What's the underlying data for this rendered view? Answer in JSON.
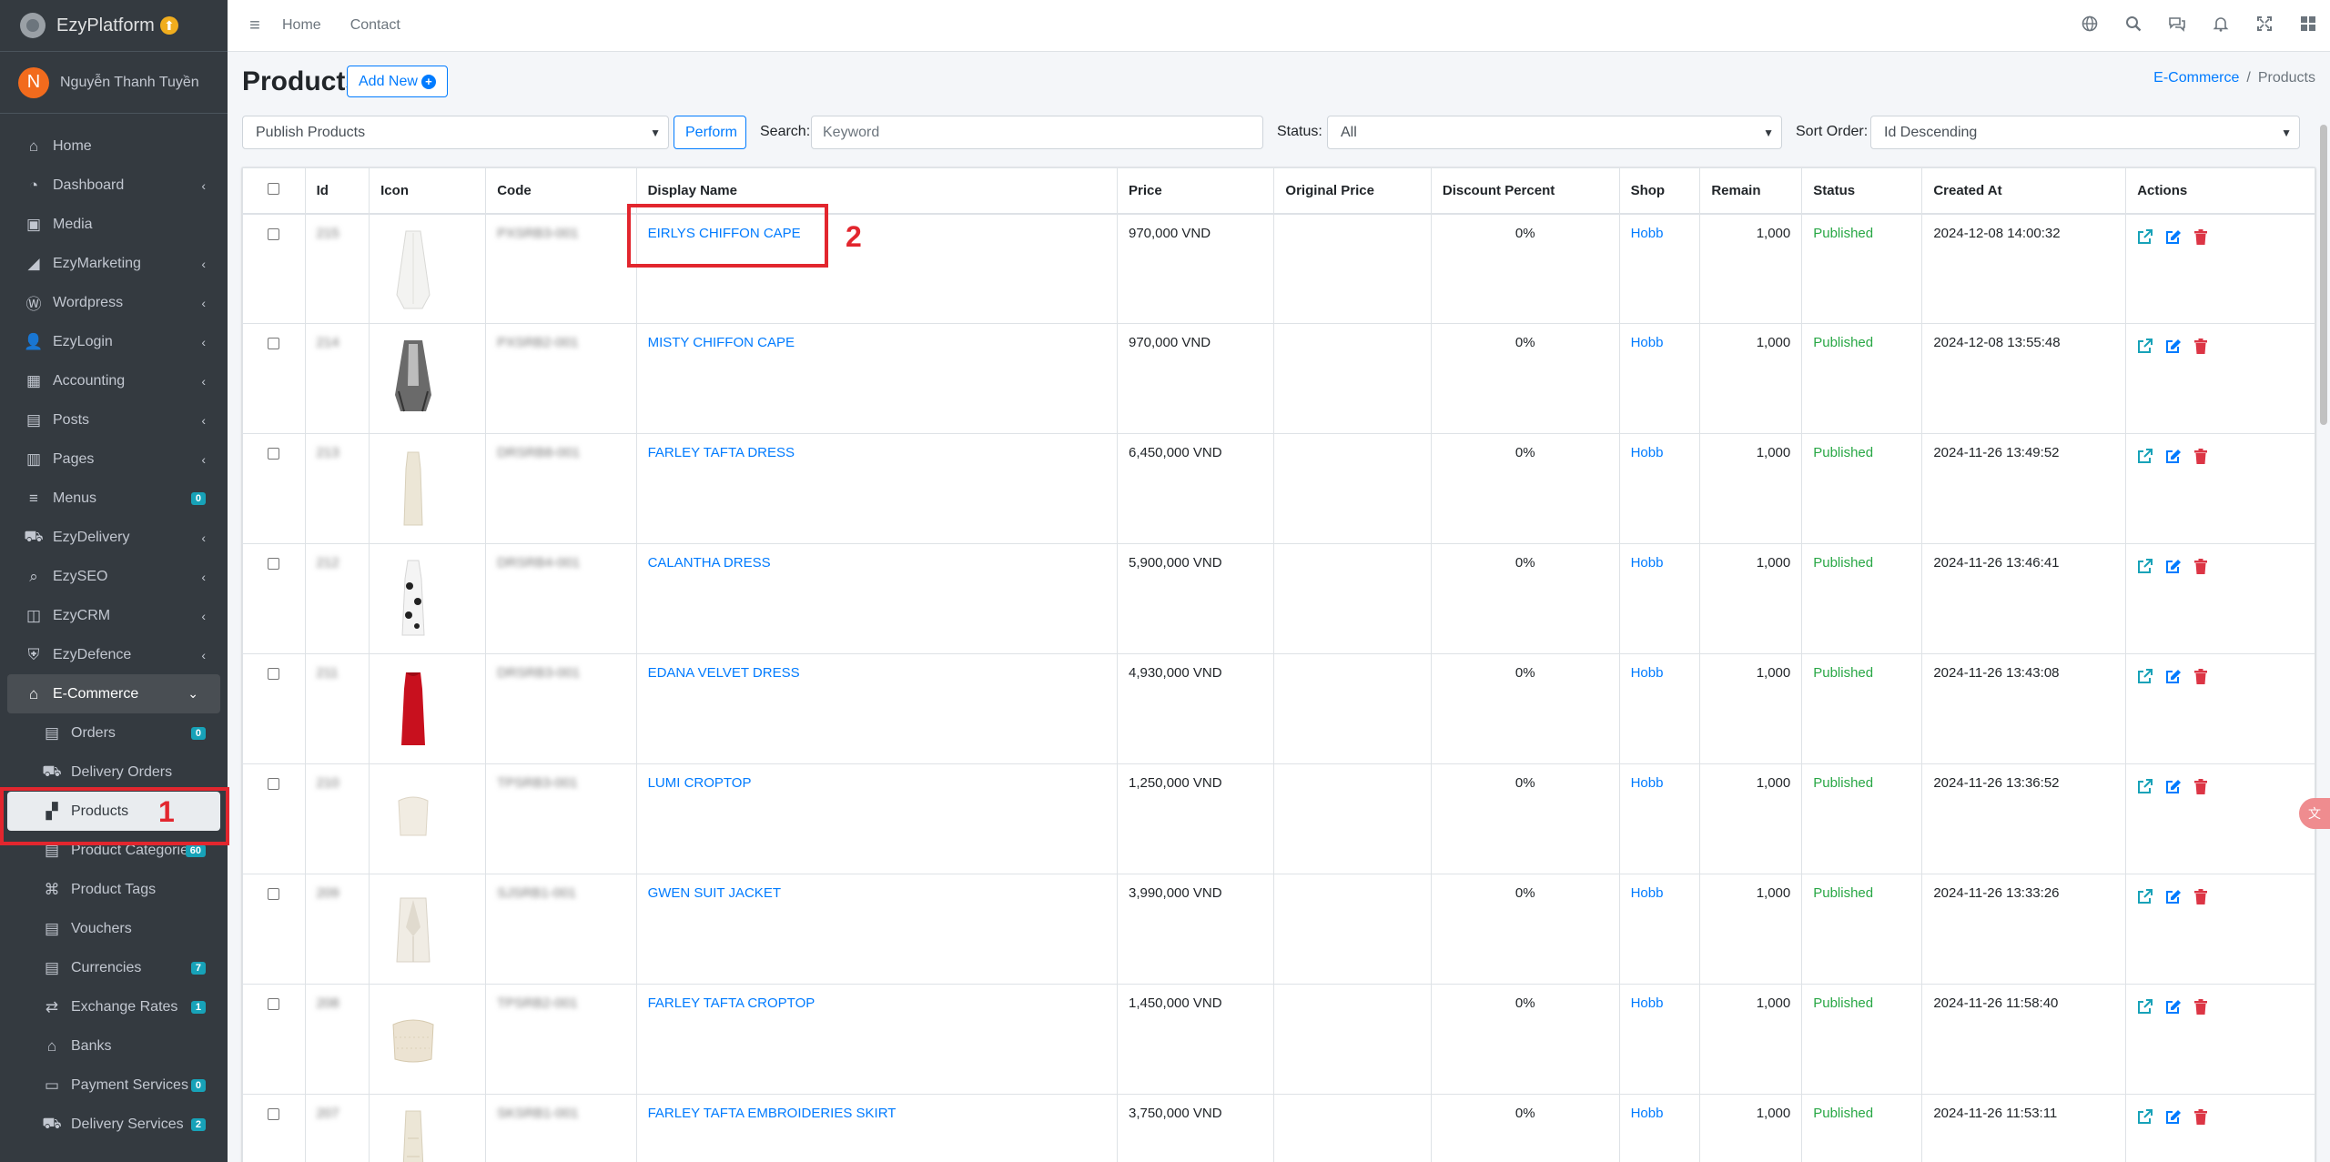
{
  "brand": {
    "name": "EzyPlatform",
    "badge": "⬆"
  },
  "user": {
    "initial": "N",
    "name": "Nguyễn Thanh Tuyền"
  },
  "sidebar": {
    "items": [
      {
        "label": "Home",
        "icon": "home-icon",
        "glyph": "⌂"
      },
      {
        "label": "Dashboard",
        "icon": "dashboard-icon",
        "glyph": "◔",
        "chev": "‹"
      },
      {
        "label": "Media",
        "icon": "media-icon",
        "glyph": "▣"
      },
      {
        "label": "EzyMarketing",
        "icon": "bullhorn-icon",
        "glyph": "◢",
        "chev": "‹"
      },
      {
        "label": "Wordpress",
        "icon": "wordpress-icon",
        "glyph": "Ⓦ",
        "chev": "‹"
      },
      {
        "label": "EzyLogin",
        "icon": "user-lock-icon",
        "glyph": "👤",
        "chev": "‹"
      },
      {
        "label": "Accounting",
        "icon": "calculator-icon",
        "glyph": "▦",
        "chev": "‹"
      },
      {
        "label": "Posts",
        "icon": "posts-icon",
        "glyph": "▤",
        "chev": "‹"
      },
      {
        "label": "Pages",
        "icon": "pages-icon",
        "glyph": "▥",
        "chev": "‹"
      },
      {
        "label": "Menus",
        "icon": "menus-icon",
        "glyph": "≡",
        "badge": "0"
      },
      {
        "label": "EzyDelivery",
        "icon": "truck-icon",
        "glyph": "⛟",
        "chev": "‹"
      },
      {
        "label": "EzySEO",
        "icon": "seo-icon",
        "glyph": "⌕",
        "chev": "‹"
      },
      {
        "label": "EzyCRM",
        "icon": "crm-icon",
        "glyph": "◫",
        "chev": "‹"
      },
      {
        "label": "EzyDefence",
        "icon": "shield-icon",
        "glyph": "⛨",
        "chev": "‹"
      }
    ],
    "open_section": {
      "label": "E-Commerce",
      "glyph": "⌂",
      "chev": "⌄"
    },
    "sub_items": [
      {
        "label": "Orders",
        "icon": "orders-icon",
        "glyph": "▤",
        "badge": "0"
      },
      {
        "label": "Delivery Orders",
        "icon": "delivery-orders-icon",
        "glyph": "⛟"
      },
      {
        "label": "Products",
        "icon": "products-icon",
        "glyph": "▞",
        "active": true
      },
      {
        "label": "Product Categories",
        "icon": "categories-icon",
        "glyph": "▤",
        "badge": "60"
      },
      {
        "label": "Product Tags",
        "icon": "tags-icon",
        "glyph": "⌘"
      },
      {
        "label": "Vouchers",
        "icon": "vouchers-icon",
        "glyph": "▤"
      },
      {
        "label": "Currencies",
        "icon": "currencies-icon",
        "glyph": "▤",
        "badge": "7"
      },
      {
        "label": "Exchange Rates",
        "icon": "exchange-icon",
        "glyph": "⇄",
        "badge": "1"
      },
      {
        "label": "Banks",
        "icon": "bank-icon",
        "glyph": "⌂"
      },
      {
        "label": "Payment Services",
        "icon": "payment-icon",
        "glyph": "▭",
        "badge": "0"
      },
      {
        "label": "Delivery Services",
        "icon": "delivery-services-icon",
        "glyph": "⛟",
        "badge": "2"
      }
    ]
  },
  "annotations": {
    "one": "1",
    "two": "2"
  },
  "topbar": {
    "menu_glyph": "≡",
    "links": [
      "Home",
      "Contact"
    ]
  },
  "page": {
    "title": "Products",
    "add_label": "Add New",
    "add_glyph": "+"
  },
  "breadcrumb": {
    "parent": "E-Commerce",
    "sep": "/",
    "current": "Products"
  },
  "filters": {
    "action_value": "Publish Products",
    "perform_label": "Perform",
    "search_label": "Search:",
    "search_placeholder": "Keyword",
    "status_label": "Status:",
    "status_value": "All",
    "sort_label": "Sort Order:",
    "sort_value": "Id Descending"
  },
  "table": {
    "headers": [
      "Id",
      "Icon",
      "Code",
      "Display Name",
      "Price",
      "Original Price",
      "Discount Percent",
      "Shop",
      "Remain",
      "Status",
      "Created At",
      "Actions"
    ],
    "rows": [
      {
        "id": "215",
        "code": "PXSRB3-001",
        "name": "EIRLYS CHIFFON CAPE",
        "price": "970,000 VND",
        "orig": "",
        "discount": "0%",
        "shop": "Hobb",
        "remain": "1,000",
        "status": "Published",
        "created": "2024-12-08 14:00:32",
        "thumb": "cape-white"
      },
      {
        "id": "214",
        "code": "PXSRB2-001",
        "name": "MISTY CHIFFON CAPE",
        "price": "970,000 VND",
        "orig": "",
        "discount": "0%",
        "shop": "Hobb",
        "remain": "1,000",
        "status": "Published",
        "created": "2024-12-08 13:55:48",
        "thumb": "cape-dark"
      },
      {
        "id": "213",
        "code": "DRSRB8-001",
        "name": "FARLEY TAFTA DRESS",
        "price": "6,450,000 VND",
        "orig": "",
        "discount": "0%",
        "shop": "Hobb",
        "remain": "1,000",
        "status": "Published",
        "created": "2024-11-26 13:49:52",
        "thumb": "dress-cream"
      },
      {
        "id": "212",
        "code": "DRSRB4-001",
        "name": "CALANTHA DRESS",
        "price": "5,900,000 VND",
        "orig": "",
        "discount": "0%",
        "shop": "Hobb",
        "remain": "1,000",
        "status": "Published",
        "created": "2024-11-26 13:46:41",
        "thumb": "dress-dots"
      },
      {
        "id": "211",
        "code": "DRSRB3-001",
        "name": "EDANA VELVET DRESS",
        "price": "4,930,000 VND",
        "orig": "",
        "discount": "0%",
        "shop": "Hobb",
        "remain": "1,000",
        "status": "Published",
        "created": "2024-11-26 13:43:08",
        "thumb": "dress-red"
      },
      {
        "id": "210",
        "code": "TPSRB3-001",
        "name": "LUMI CROPTOP",
        "price": "1,250,000 VND",
        "orig": "",
        "discount": "0%",
        "shop": "Hobb",
        "remain": "1,000",
        "status": "Published",
        "created": "2024-11-26 13:36:52",
        "thumb": "top-cream"
      },
      {
        "id": "209",
        "code": "SJSRB1-001",
        "name": "GWEN SUIT JACKET",
        "price": "3,990,000 VND",
        "orig": "",
        "discount": "0%",
        "shop": "Hobb",
        "remain": "1,000",
        "status": "Published",
        "created": "2024-11-26 13:33:26",
        "thumb": "jacket-cream"
      },
      {
        "id": "208",
        "code": "TPSRB2-001",
        "name": "FARLEY TAFTA CROPTOP",
        "price": "1,450,000 VND",
        "orig": "",
        "discount": "0%",
        "shop": "Hobb",
        "remain": "1,000",
        "status": "Published",
        "created": "2024-11-26 11:58:40",
        "thumb": "top-feather"
      },
      {
        "id": "207",
        "code": "SKSRB1-001",
        "name": "FARLEY TAFTA EMBROIDERIES SKIRT",
        "price": "3,750,000 VND",
        "orig": "",
        "discount": "0%",
        "shop": "Hobb",
        "remain": "1,000",
        "status": "Published",
        "created": "2024-11-26 11:53:11",
        "thumb": "skirt-cream"
      }
    ]
  },
  "colors": {
    "primary": "#007bff",
    "success": "#28a745",
    "danger": "#dc3545",
    "info": "#17a2b8",
    "annotation": "#e2262e"
  }
}
